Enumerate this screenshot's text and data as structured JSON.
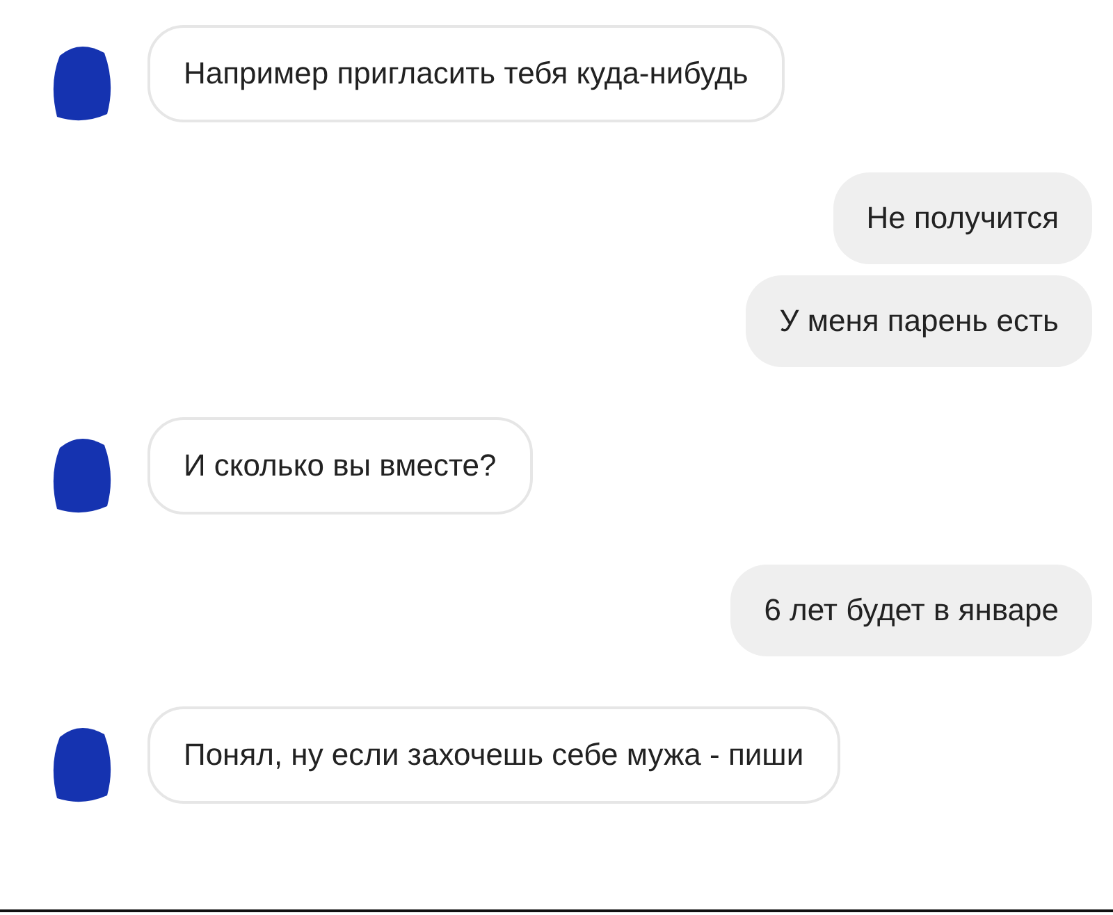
{
  "messages": [
    {
      "kind": "incoming",
      "text": "Например пригласить тебя куда-нибудь"
    },
    {
      "kind": "outgoing",
      "text": "Не получится"
    },
    {
      "kind": "outgoing",
      "text": "У меня парень есть"
    },
    {
      "kind": "incoming",
      "text": "И сколько вы вместе?"
    },
    {
      "kind": "outgoing",
      "text": "6 лет будет в январе"
    },
    {
      "kind": "incoming",
      "text": "Понял, ну если захочешь себе мужа - пиши"
    }
  ]
}
